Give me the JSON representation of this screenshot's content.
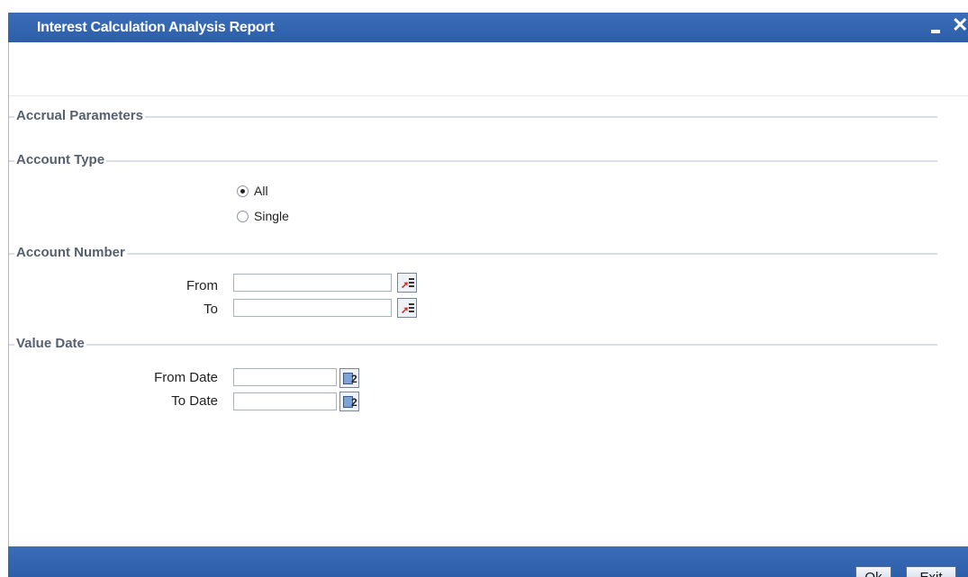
{
  "window": {
    "title": "Interest Calculation Analysis Report",
    "close_glyph": "✕"
  },
  "sections": {
    "accrual": "Accrual Parameters",
    "account_type": "Account Type",
    "account_number": "Account Number",
    "value_date": "Value Date"
  },
  "account_type": {
    "options": [
      {
        "label": "All",
        "checked": true
      },
      {
        "label": "Single",
        "checked": false
      }
    ]
  },
  "account_number": {
    "from_label": "From",
    "to_label": "To",
    "from_value": "",
    "to_value": ""
  },
  "value_date": {
    "from_label": "From Date",
    "to_label": "To Date",
    "from_value": "",
    "to_value": ""
  },
  "footer": {
    "ok_label": "Ok",
    "exit_label": "Exit"
  },
  "icons": {
    "lov": "list-of-values-icon",
    "calendar": "calendar-icon"
  },
  "colors": {
    "titlebar": "#2d5ea9",
    "section_text": "#555f6e"
  }
}
